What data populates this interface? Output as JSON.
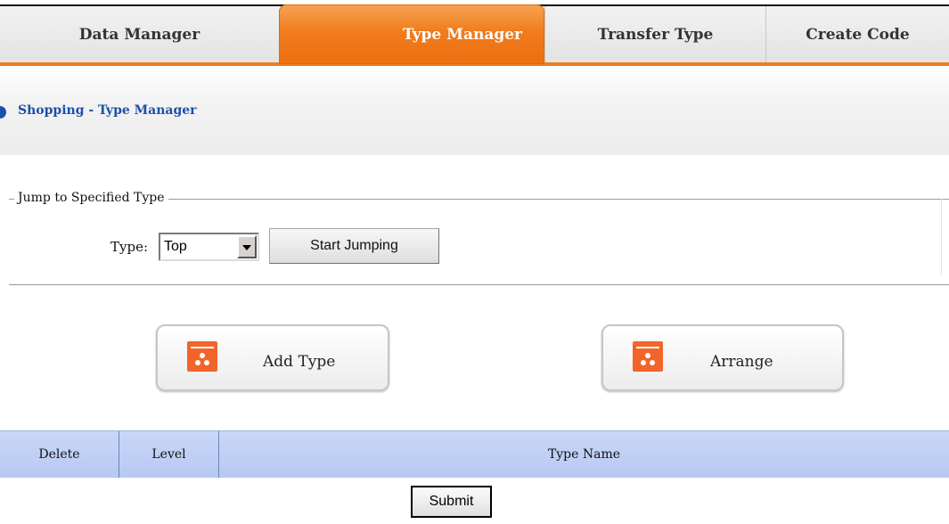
{
  "tabs": [
    {
      "label": "Data Manager",
      "active": false
    },
    {
      "label": "Type Manager",
      "active": true
    },
    {
      "label": "Transfer Type",
      "active": false
    },
    {
      "label": "Create Code",
      "active": false
    }
  ],
  "breadcrumb": "Shopping - Type Manager",
  "jump": {
    "legend": "Jump to Specified Type",
    "type_label": "Type:",
    "selected": "Top",
    "button": "Start Jumping"
  },
  "actions": {
    "add_type": "Add Type",
    "arrange": "Arrange"
  },
  "table": {
    "columns": [
      "Delete",
      "Level",
      "Type Name"
    ]
  },
  "submit_label": "Submit",
  "colors": {
    "accent": "#f07c1d",
    "link": "#1b4fa8",
    "header_bg": "#c0cff5",
    "icon": "#f2652a"
  }
}
